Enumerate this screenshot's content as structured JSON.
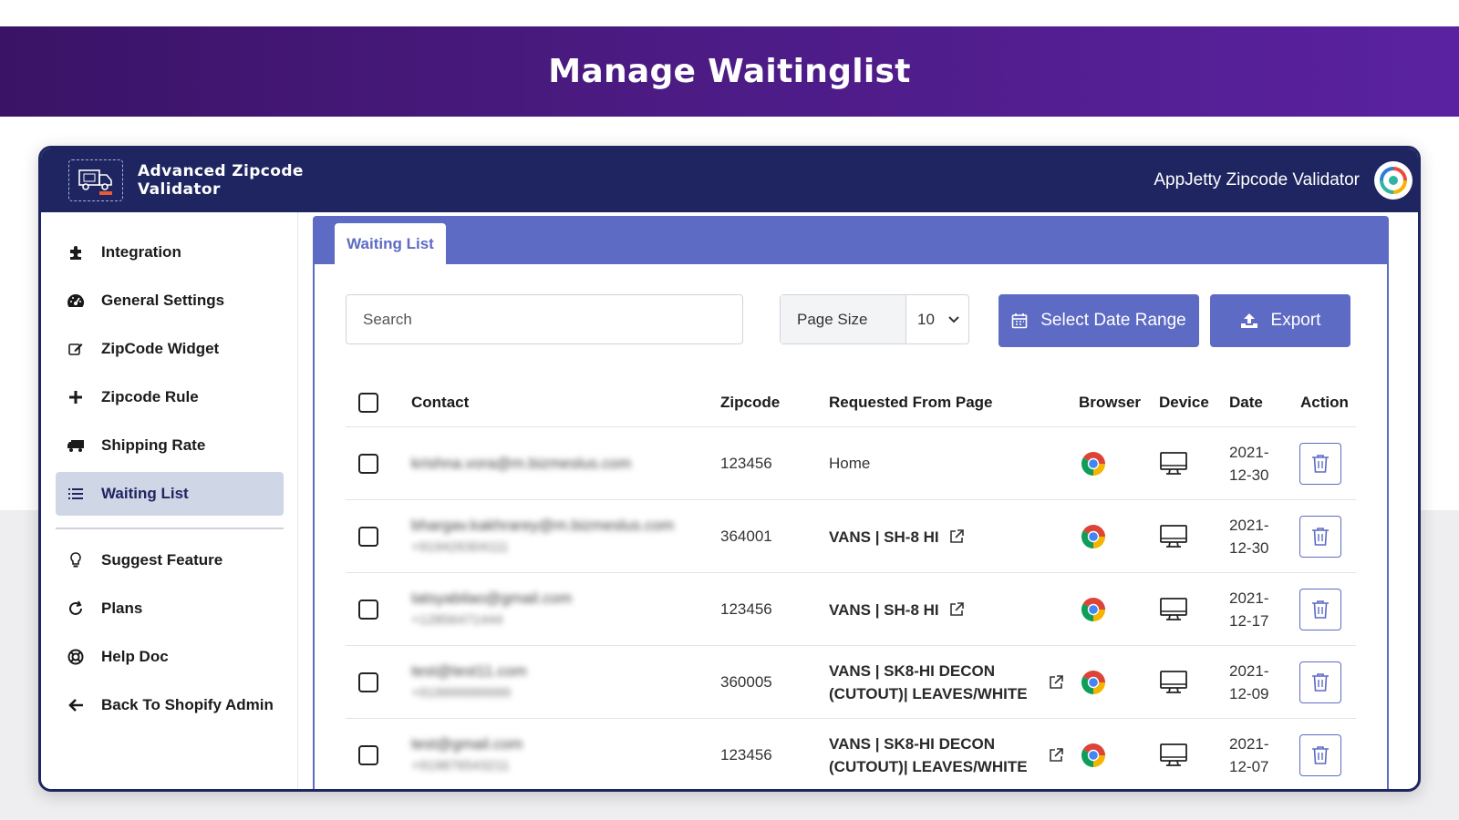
{
  "banner": {
    "title": "Manage Waitinglist"
  },
  "app": {
    "logo_text_line1": "Advanced Zipcode",
    "logo_text_line2": "Validator",
    "app_name": "AppJetty Zipcode Validator"
  },
  "sidebar": {
    "items": [
      {
        "label": "Integration",
        "icon": "puzzle-icon"
      },
      {
        "label": "General Settings",
        "icon": "dashboard-icon"
      },
      {
        "label": "ZipCode Widget",
        "icon": "edit-icon"
      },
      {
        "label": "Zipcode Rule",
        "icon": "plus-icon"
      },
      {
        "label": "Shipping Rate",
        "icon": "truck-icon"
      },
      {
        "label": "Waiting List",
        "icon": "list-icon",
        "active": true
      },
      {
        "label": "Suggest Feature",
        "icon": "lightbulb-icon"
      },
      {
        "label": "Plans",
        "icon": "refresh-icon"
      },
      {
        "label": "Help Doc",
        "icon": "lifering-icon"
      },
      {
        "label": "Back To Shopify Admin",
        "icon": "arrow-left-icon"
      }
    ]
  },
  "main": {
    "tab_label": "Waiting List",
    "search_placeholder": "Search",
    "page_size_label": "Page Size",
    "page_size_value": "10",
    "date_range_label": "Select Date Range",
    "export_label": "Export"
  },
  "table": {
    "headers": [
      "Contact",
      "Zipcode",
      "Requested From Page",
      "Browser",
      "Device",
      "Date",
      "Action"
    ],
    "rows": [
      {
        "contact": "krishna.vora@m.bizmeslus.com",
        "contact_sub": "",
        "zipcode": "123456",
        "page_line1": "Home",
        "page_line2": "",
        "page_bold": false,
        "has_link": false,
        "browser": "chrome-icon",
        "device": "desktop-icon",
        "date_line1": "2021-",
        "date_line2": "12-30"
      },
      {
        "contact": "bhargav.kakhrarey@m.bizmeslus.com",
        "contact_sub": "+919426304111",
        "zipcode": "364001",
        "page_line1": "VANS | SH-8 HI",
        "page_line2": "",
        "page_bold": true,
        "has_link": true,
        "browser": "chrome-icon",
        "device": "desktop-icon",
        "date_line1": "2021-",
        "date_line2": "12-30"
      },
      {
        "contact": "tatsyabilao@gmail.com",
        "contact_sub": "+12856471444",
        "zipcode": "123456",
        "page_line1": "VANS | SH-8 HI",
        "page_line2": "",
        "page_bold": true,
        "has_link": true,
        "browser": "chrome-icon",
        "device": "desktop-icon",
        "date_line1": "2021-",
        "date_line2": "12-17"
      },
      {
        "contact": "test@test11.com",
        "contact_sub": "+919999999999",
        "zipcode": "360005",
        "page_line1": "VANS | SK8-HI DECON",
        "page_line2": "(CUTOUT)| LEAVES/WHITE",
        "page_bold": true,
        "has_link": true,
        "browser": "chrome-icon",
        "device": "desktop-icon",
        "date_line1": "2021-",
        "date_line2": "12-09"
      },
      {
        "contact": "test@gmail.com",
        "contact_sub": "+919876543211",
        "zipcode": "123456",
        "page_line1": "VANS | SK8-HI DECON",
        "page_line2": "(CUTOUT)| LEAVES/WHITE",
        "page_bold": true,
        "has_link": true,
        "browser": "chrome-icon",
        "device": "desktop-icon",
        "date_line1": "2021-",
        "date_line2": "12-07"
      }
    ]
  },
  "colors": {
    "banner": "#4a1a80",
    "topbar": "#1f2560",
    "accent": "#5d6bc4",
    "active_nav": "#cfd6e6"
  }
}
